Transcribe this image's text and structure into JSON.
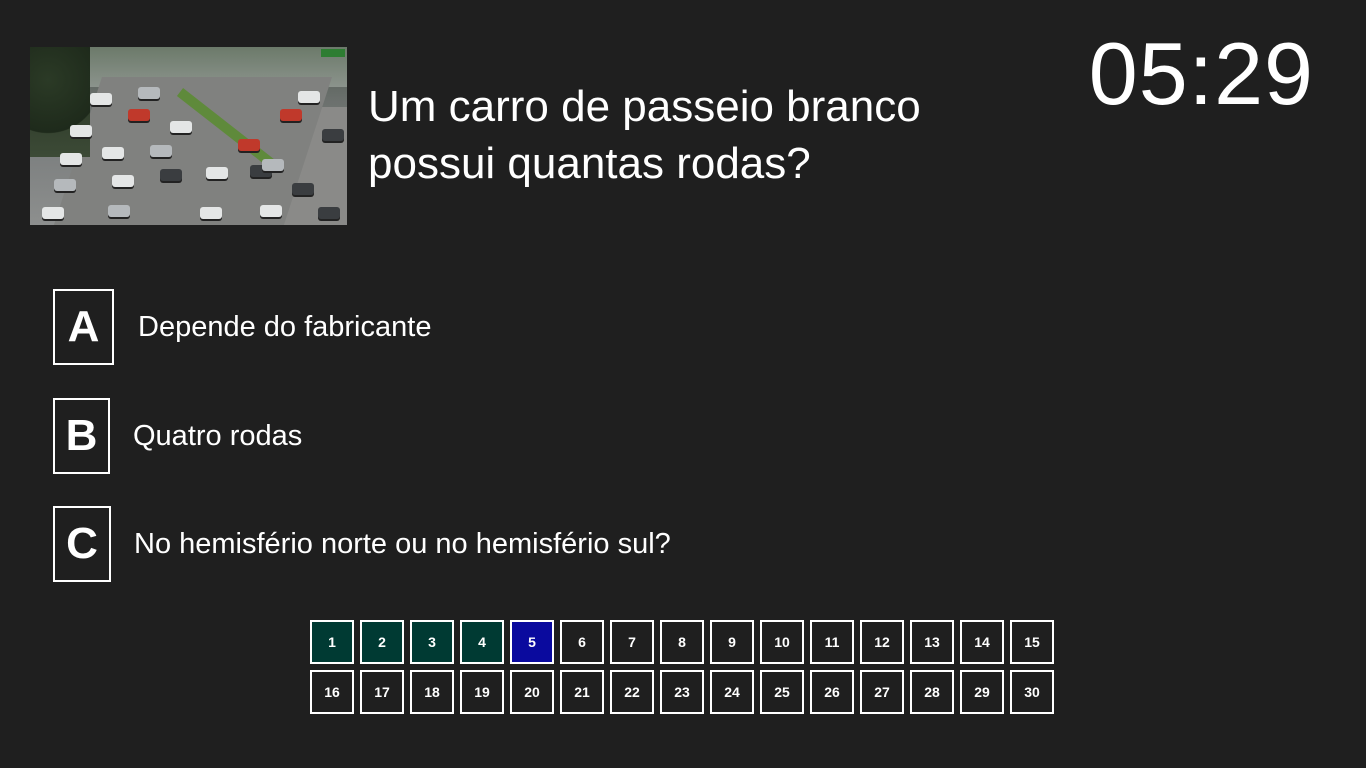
{
  "question": {
    "text_line1": "Um carro de passeio branco",
    "text_line2": "possui quantas rodas?",
    "image_icon": "traffic-photo"
  },
  "timer": {
    "value": "05:29"
  },
  "options": [
    {
      "letter": "A",
      "text": "Depende do fabricante"
    },
    {
      "letter": "B",
      "text": "Quatro rodas"
    },
    {
      "letter": "C",
      "text": "No hemisfério norte ou no hemisfério sul?"
    }
  ],
  "navigation": {
    "questions": [
      "1",
      "2",
      "3",
      "4",
      "5",
      "6",
      "7",
      "8",
      "9",
      "10",
      "11",
      "12",
      "13",
      "14",
      "15",
      "16",
      "17",
      "18",
      "19",
      "20",
      "21",
      "22",
      "23",
      "24",
      "25",
      "26",
      "27",
      "28",
      "29",
      "30"
    ],
    "answered": [
      1,
      2,
      3,
      4
    ],
    "current": 5,
    "colors": {
      "answered": "#003a33",
      "current": "#0a0a9e",
      "background": "#1f1f1f"
    }
  }
}
